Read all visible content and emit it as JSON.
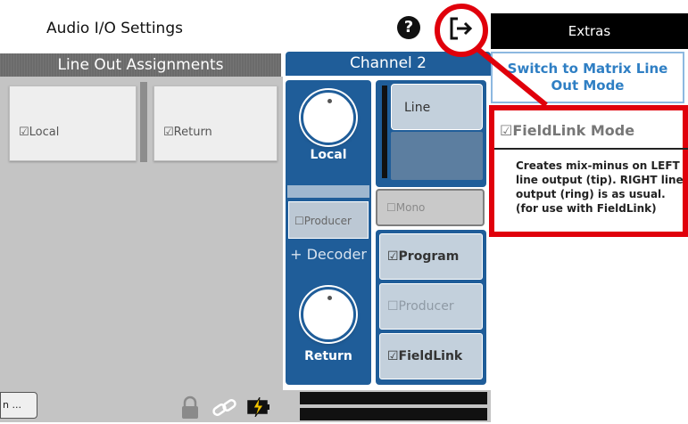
{
  "header": {
    "title": "Audio I/O Settings",
    "help_icon": "?"
  },
  "line_out": {
    "title": "Line Out Assignments",
    "cards": [
      {
        "label": "☑Local"
      },
      {
        "label": "☑Return"
      }
    ]
  },
  "channel": {
    "title": "Channel 2",
    "knob_local_label": "Local",
    "knob_return_label": "Return",
    "producer_small": "☐Producer",
    "decoder": "+ Decoder",
    "line_button": "Line",
    "mono": "☐Mono",
    "buttons": [
      {
        "label": "☑Program"
      },
      {
        "label": "☐Producer"
      },
      {
        "label": "☑FieldLink"
      }
    ]
  },
  "bottom": {
    "menu_button": "n ..."
  },
  "extras": {
    "title": "Extras",
    "switch_button": "Switch to Matrix Line Out Mode",
    "fieldlink_title": "☑FieldLink Mode",
    "fieldlink_desc": "Creates mix-minus on LEFT line output (tip). RIGHT line output (ring) is as usual. (for use with FieldLink)"
  },
  "colors": {
    "channel_blue": "#1f5d99",
    "highlight_red": "#e0000b",
    "extras_bg": "#000000",
    "switch_text": "#2f7fc4"
  }
}
